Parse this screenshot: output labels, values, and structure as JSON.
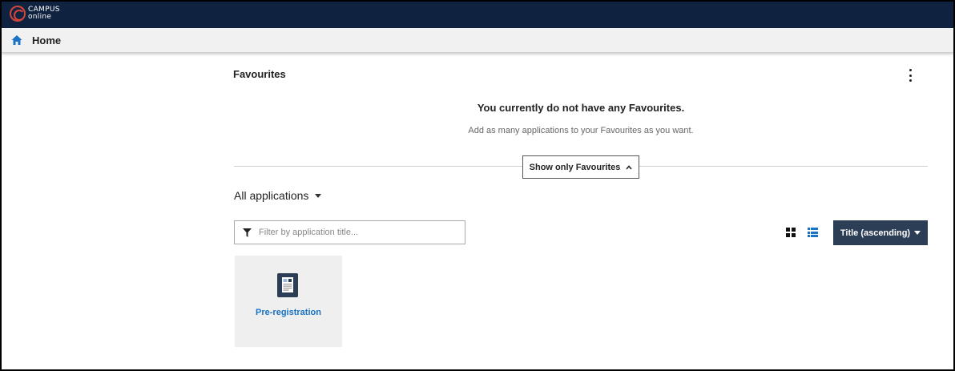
{
  "header": {
    "logo_line1": "CAMPUS",
    "logo_line2": "online",
    "icon": "campus-online-logo",
    "background": "#0f2340",
    "accent": "#d4453a"
  },
  "breadcrumb": {
    "home_label": "Home",
    "icon": "home-icon"
  },
  "favourites": {
    "title": "Favourites",
    "menu_icon": "kebab-menu-icon",
    "empty_title": "You currently do not have any Favourites.",
    "empty_subtitle": "Add as many applications to your Favourites as you want.",
    "toggle_label": "Show only Favourites"
  },
  "applications": {
    "heading": "All applications",
    "filter_placeholder": "Filter by application title...",
    "filter_value": "",
    "sort_label": "Title (ascending)",
    "view_grid_icon": "grid-view-icon",
    "view_list_icon": "list-view-icon",
    "items": [
      {
        "label": "Pre-registration",
        "icon": "document-id-icon"
      }
    ]
  },
  "colors": {
    "link": "#1a73c4",
    "button_dark": "#2c3e55"
  }
}
